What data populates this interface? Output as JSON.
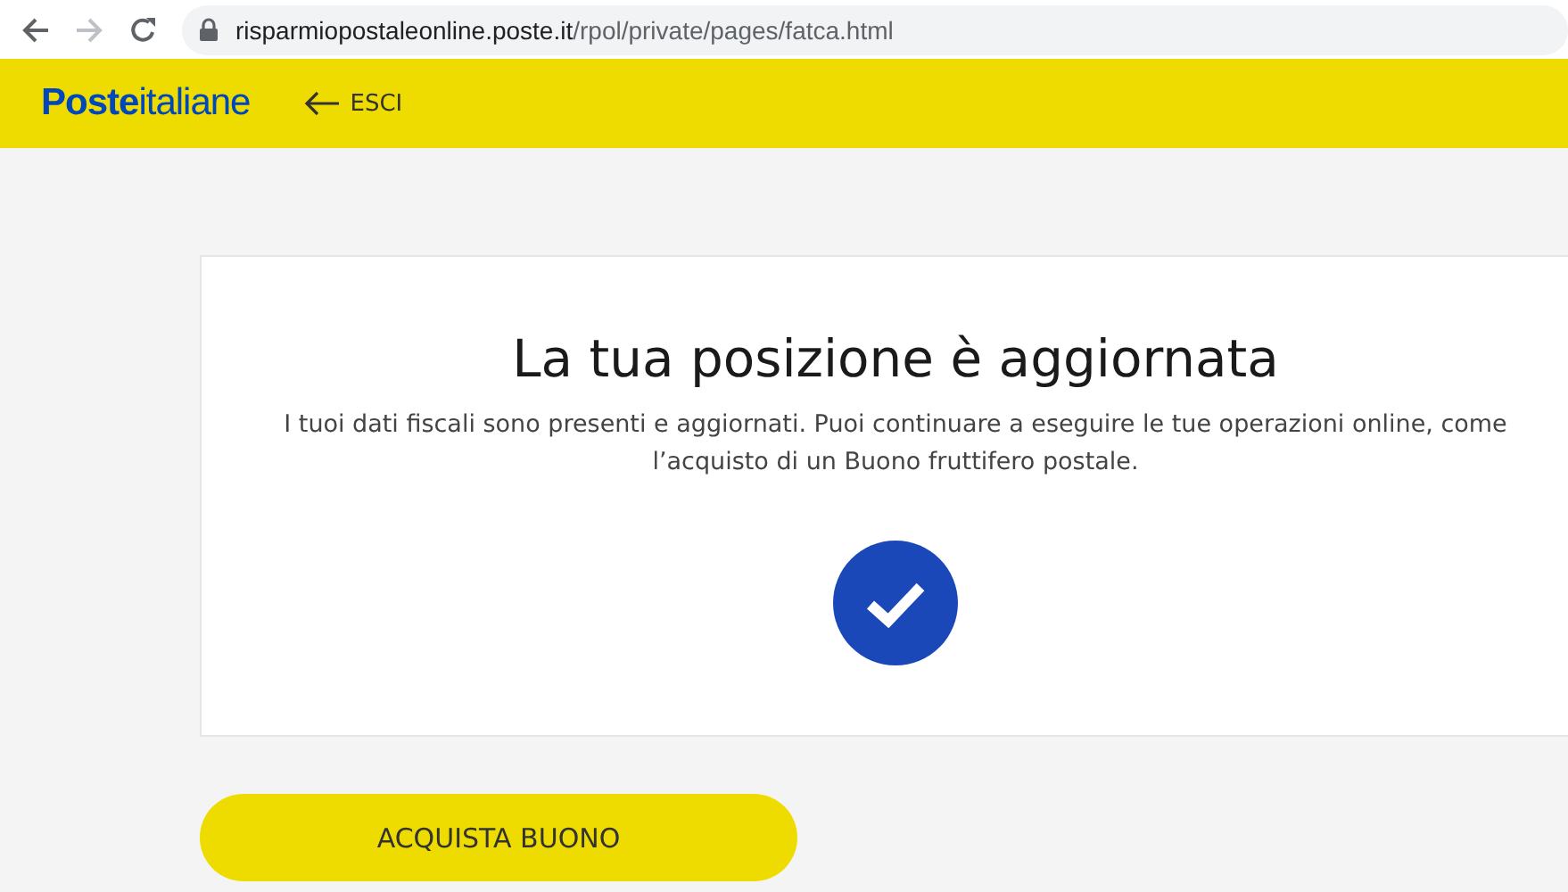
{
  "browser": {
    "url_host": "risparmiopostaleonline.poste.it",
    "url_path": "/rpol/private/pages/fatca.html",
    "forward_disabled": true
  },
  "header": {
    "logo": "**Poste**italiane",
    "exit_label": "ESCI"
  },
  "card": {
    "title": "La tua posizione è aggiornata",
    "message": "I tuoi dati fiscali sono presenti e aggiornati. Puoi continuare a eseguire le tue operazioni online, come l’acquisto di un Buono fruttifero postale.",
    "checked": true
  },
  "button": "ACQUISTA BUONO"
}
